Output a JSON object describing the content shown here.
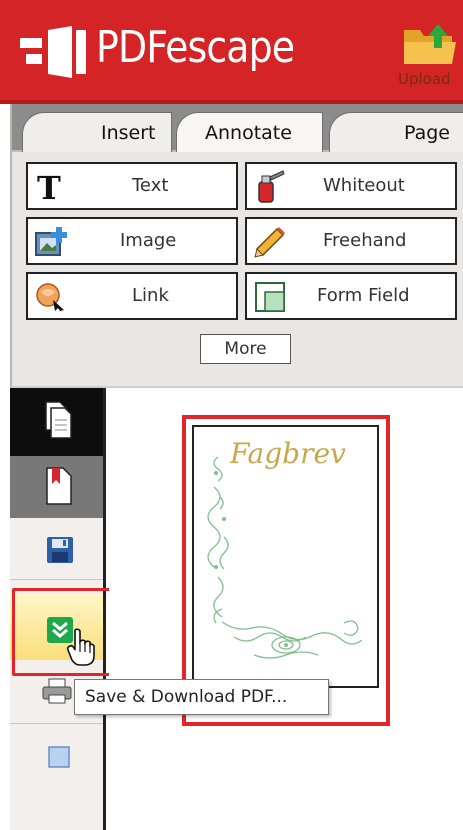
{
  "app": {
    "name": "PDFescape",
    "upload_label": "Upload"
  },
  "tabs": [
    {
      "label": "Insert"
    },
    {
      "label": "Annotate"
    },
    {
      "label": "Page"
    }
  ],
  "tools": [
    {
      "label": "Text",
      "icon": "text-tool-icon"
    },
    {
      "label": "Whiteout",
      "icon": "whiteout-icon"
    },
    {
      "label": "Image",
      "icon": "image-icon"
    },
    {
      "label": "Freehand",
      "icon": "pencil-icon"
    },
    {
      "label": "Link",
      "icon": "link-icon"
    },
    {
      "label": "Form Field",
      "icon": "form-field-icon"
    }
  ],
  "more_label": "More",
  "sidebar": [
    {
      "name": "pages",
      "icon": "pages-icon"
    },
    {
      "name": "bookmarks",
      "icon": "bookmark-icon"
    },
    {
      "name": "save",
      "icon": "save-icon"
    },
    {
      "name": "save-download",
      "icon": "download-icon"
    },
    {
      "name": "print",
      "icon": "print-icon"
    },
    {
      "name": "thumbnail",
      "icon": "thumbnail-icon"
    }
  ],
  "tooltip": "Save & Download PDF...",
  "document": {
    "heading": "Fagbrev"
  },
  "colors": {
    "brand": "#d42426",
    "highlight": "#e0262b",
    "download_green": "#1fa84a"
  }
}
